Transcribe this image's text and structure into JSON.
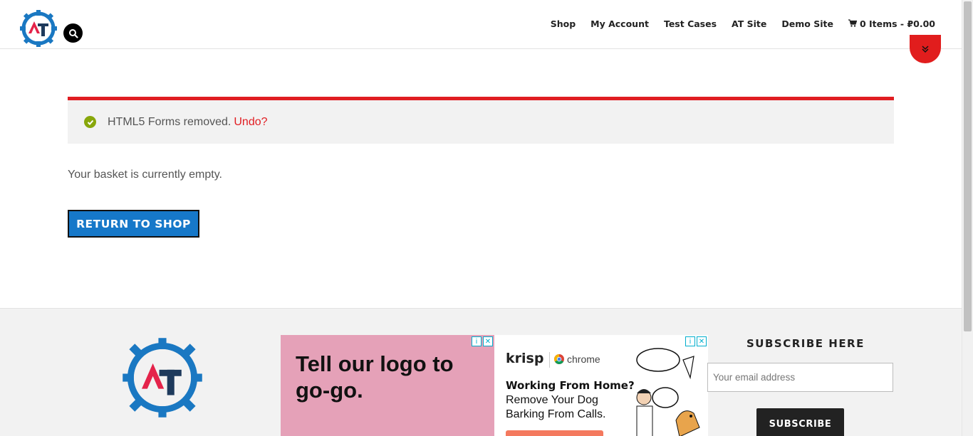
{
  "header": {
    "nav": [
      "Shop",
      "My Account",
      "Test Cases",
      "AT Site",
      "Demo Site"
    ],
    "cart_label": "0 Items - ₽0.00"
  },
  "notice": {
    "message": "HTML5 Forms removed.",
    "undo_label": "Undo?"
  },
  "basket": {
    "empty_message": "Your basket is currently empty.",
    "return_button": "RETURN TO SHOP"
  },
  "ads": {
    "ad1_text": "Tell our logo to go-go.",
    "ad2_brand": "krisp",
    "ad2_partner": "chrome",
    "ad2_headline": "Working From Home?",
    "ad2_sub": "Remove Your Dog Barking From Calls."
  },
  "subscribe": {
    "title": "SUBSCRIBE HERE",
    "email_placeholder": "Your email address",
    "button": "SUBSCRIBE"
  },
  "colors": {
    "accent": "#e11d22",
    "button_blue": "#1678c9",
    "success": "#88a70b"
  }
}
